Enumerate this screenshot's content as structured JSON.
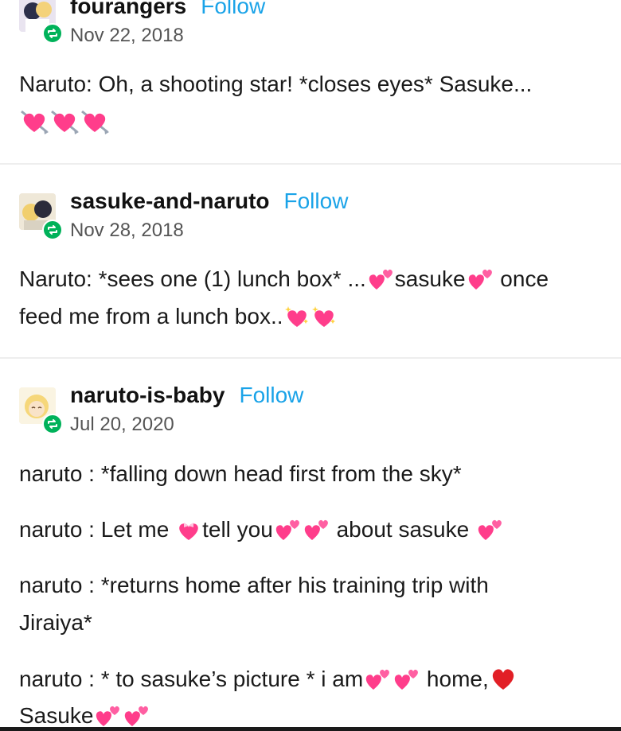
{
  "posts": [
    {
      "username": "fourangers",
      "follow_label": "Follow",
      "date": "Nov 22, 2018",
      "lines": [
        "Naruto: Oh, a shooting star! *closes eyes* Sasuke..."
      ]
    },
    {
      "username": "sasuke-and-naruto",
      "follow_label": "Follow",
      "date": "Nov 28, 2018",
      "l1_a": "Naruto: *sees one (1) lunch box* ...",
      "l1_b": "sasuke",
      "l1_c": " once",
      "l2_a": "feed me from a lunch box.."
    },
    {
      "username": "naruto-is-baby",
      "follow_label": "Follow",
      "date": "Jul 20, 2020",
      "l1": "naruto : *falling down head first from the sky*",
      "l2_a": "naruto : Let me ",
      "l2_b": "tell you",
      "l2_c": " about sasuke ",
      "l3": "naruto : *returns home after his training trip with",
      "l4": "Jiraiya*",
      "l5_a": "naruto : * to sasuke’s picture * i am",
      "l5_b": " home,",
      "l6_a": "Sasuke"
    }
  ],
  "icons": {
    "reblog": "reblog-icon",
    "heart_arrow": "heart-with-arrow-icon",
    "two_hearts": "two-hearts-icon",
    "sparkling_heart": "sparkling-heart-icon",
    "ribbon_heart": "heart-with-ribbon-icon",
    "red_heart": "red-heart-icon"
  },
  "colors": {
    "follow": "#1aa3e8",
    "reblog_badge": "#00b25a",
    "pink_heart": "#ff3d8b",
    "red_heart": "#e21f26"
  }
}
